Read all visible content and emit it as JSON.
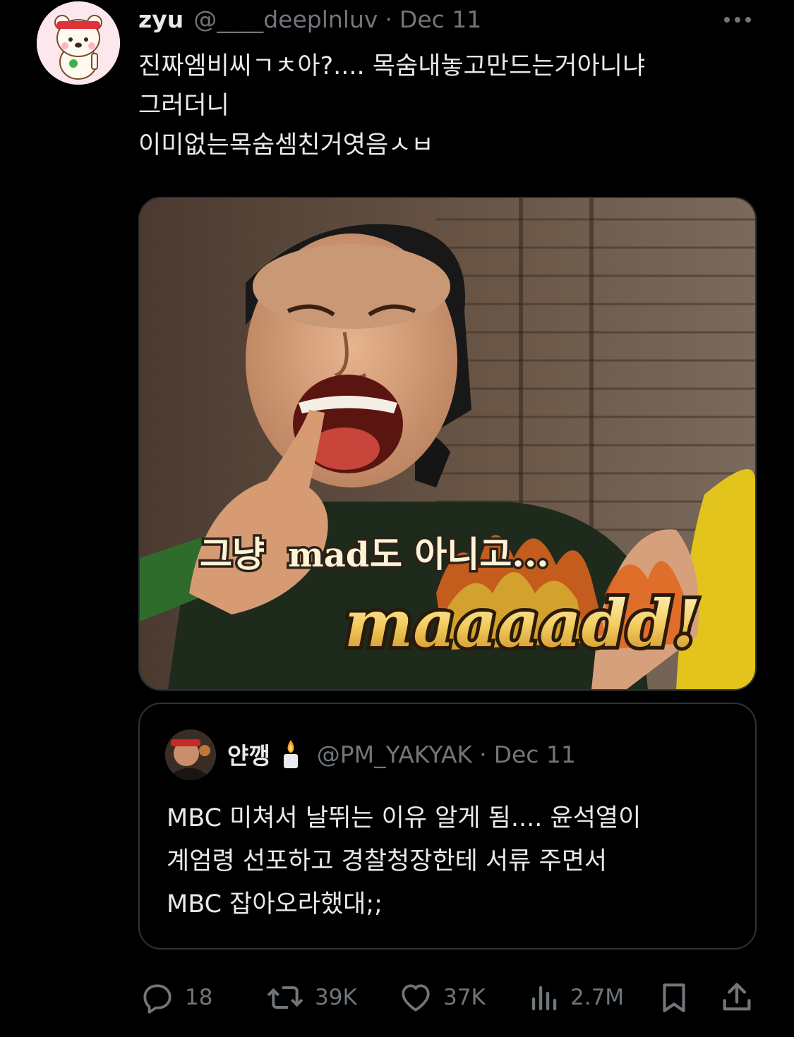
{
  "post": {
    "display_name": "zyu",
    "handle": "@____deeplnluv",
    "separator": "·",
    "date": "Dec 11",
    "text_lines": [
      "진짜엠비씨ㄱㅊ아?.... 목숨내놓고만드는거아니냐",
      "그러더니",
      "이미없는목숨셈친거엿음ㅅㅂ"
    ],
    "media": {
      "caption_top_hangul_1": "그냥",
      "caption_top_latin": "mad",
      "caption_top_hangul_2": "도 아니고...",
      "caption_big": "maaaadd!"
    }
  },
  "quoted_post": {
    "display_name": "얀깽",
    "handle": "@PM_YAKYAK",
    "separator": "·",
    "date": "Dec 11",
    "text_lines": [
      "MBC 미쳐서 날뛰는 이유 알게 됨.... 윤석열이",
      "계엄령 선포하고 경찰청장한테 서류 주면서",
      "MBC 잡아오라했대;;"
    ]
  },
  "actions": {
    "replies": "18",
    "reposts": "39K",
    "likes": "37K",
    "views": "2.7M"
  },
  "icons": {
    "more": "more-icon",
    "reply": "reply-icon",
    "repost": "repost-icon",
    "like": "heart-icon",
    "views": "views-icon",
    "bookmark": "bookmark-icon",
    "share": "share-icon"
  },
  "colors": {
    "background": "#000000",
    "text": "#e7e9ea",
    "secondary": "#71767b",
    "border": "#2f3336"
  }
}
